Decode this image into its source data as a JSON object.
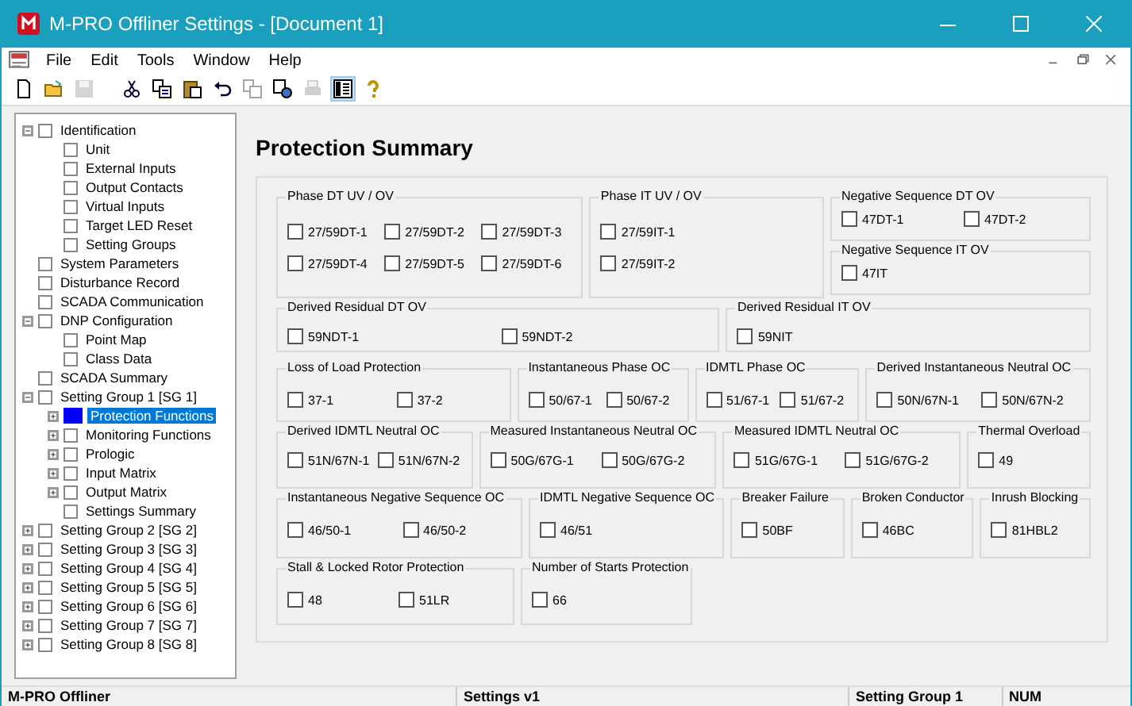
{
  "window": {
    "title": "M-PRO Offliner Settings - [Document 1]"
  },
  "menu": [
    "File",
    "Edit",
    "Tools",
    "Window",
    "Help"
  ],
  "toolbar": [
    {
      "kind": "new",
      "disabled": false,
      "selected": false
    },
    {
      "kind": "open",
      "disabled": false,
      "selected": false
    },
    {
      "kind": "save",
      "disabled": true,
      "selected": false
    },
    {
      "kind": "sep"
    },
    {
      "kind": "cut",
      "disabled": false,
      "selected": false
    },
    {
      "kind": "copy",
      "disabled": false,
      "selected": false
    },
    {
      "kind": "paste",
      "disabled": false,
      "selected": false
    },
    {
      "kind": "undo",
      "disabled": false,
      "selected": false
    },
    {
      "kind": "compare",
      "disabled": true,
      "selected": false
    },
    {
      "kind": "merge",
      "disabled": false,
      "selected": false
    },
    {
      "kind": "print",
      "disabled": true,
      "selected": false
    },
    {
      "kind": "view",
      "disabled": false,
      "selected": true
    },
    {
      "kind": "help",
      "disabled": false,
      "selected": false
    }
  ],
  "tree": [
    {
      "label": "Identification",
      "checked": false,
      "selected": false,
      "expanded": true,
      "children": [
        {
          "label": "Unit",
          "checked": false,
          "selected": false
        },
        {
          "label": "External Inputs",
          "checked": false,
          "selected": false
        },
        {
          "label": "Output Contacts",
          "checked": false,
          "selected": false
        },
        {
          "label": "Virtual Inputs",
          "checked": false,
          "selected": false
        },
        {
          "label": "Target LED Reset",
          "checked": false,
          "selected": false
        },
        {
          "label": "Setting Groups",
          "checked": false,
          "selected": false
        }
      ]
    },
    {
      "label": "System Parameters",
      "checked": false,
      "selected": false
    },
    {
      "label": "Disturbance Record",
      "checked": false,
      "selected": false
    },
    {
      "label": "SCADA Communication",
      "checked": false,
      "selected": false
    },
    {
      "label": "DNP Configuration",
      "checked": false,
      "selected": false,
      "expanded": true,
      "children": [
        {
          "label": "Point Map",
          "checked": false,
          "selected": false
        },
        {
          "label": "Class Data",
          "checked": false,
          "selected": false
        }
      ]
    },
    {
      "label": "SCADA Summary",
      "checked": false,
      "selected": false
    },
    {
      "label": "Setting Group 1 [SG 1]",
      "checked": false,
      "selected": false,
      "expanded": true,
      "children": [
        {
          "label": "Protection Functions",
          "checked": true,
          "selected": true,
          "expanded": false
        },
        {
          "label": "Monitoring Functions",
          "checked": false,
          "selected": false,
          "expanded": false
        },
        {
          "label": "Prologic",
          "checked": false,
          "selected": false,
          "expanded": false
        },
        {
          "label": "Input Matrix",
          "checked": false,
          "selected": false,
          "expanded": false
        },
        {
          "label": "Output Matrix",
          "checked": false,
          "selected": false,
          "expanded": false
        },
        {
          "label": "Settings Summary",
          "checked": false,
          "selected": false
        }
      ]
    },
    {
      "label": "Setting Group 2 [SG 2]",
      "checked": false,
      "selected": false,
      "expanded": false
    },
    {
      "label": "Setting Group 3 [SG 3]",
      "checked": false,
      "selected": false,
      "expanded": false
    },
    {
      "label": "Setting Group 4 [SG 4]",
      "checked": false,
      "selected": false,
      "expanded": false
    },
    {
      "label": "Setting Group 5 [SG 5]",
      "checked": false,
      "selected": false,
      "expanded": false
    },
    {
      "label": "Setting Group 6 [SG 6]",
      "checked": false,
      "selected": false,
      "expanded": false
    },
    {
      "label": "Setting Group 7 [SG 7]",
      "checked": false,
      "selected": false,
      "expanded": false
    },
    {
      "label": "Setting Group 8 [SG 8]",
      "checked": false,
      "selected": false,
      "expanded": false
    }
  ],
  "heading": "Protection Summary",
  "rows": [
    {
      "groups": [
        {
          "kind": "group",
          "title": "Phase DT UV / OV",
          "items": [
            {
              "label": "27/59DT-1",
              "checked": false
            },
            {
              "label": "27/59DT-2",
              "checked": false
            },
            {
              "label": "27/59DT-3",
              "checked": false
            },
            {
              "label": "27/59DT-4",
              "checked": false
            },
            {
              "label": "27/59DT-5",
              "checked": false
            },
            {
              "label": "27/59DT-6",
              "checked": false
            }
          ]
        },
        {
          "kind": "group",
          "title": "Phase IT UV / OV",
          "items": [
            {
              "label": "27/59IT-1",
              "checked": false
            },
            {
              "label": "27/59IT-2",
              "checked": false
            }
          ]
        },
        {
          "kind": "stack",
          "groups": [
            {
              "kind": "group",
              "title": "Negative Sequence DT OV",
              "items": [
                {
                  "label": "47DT-1",
                  "checked": false
                },
                {
                  "label": "47DT-2",
                  "checked": false
                }
              ]
            },
            {
              "kind": "group",
              "title": "Negative Sequence IT OV",
              "items": [
                {
                  "label": "47IT",
                  "checked": false
                }
              ]
            }
          ]
        }
      ]
    },
    {
      "groups": [
        {
          "kind": "group",
          "title": "Derived Residual DT OV",
          "items": [
            {
              "label": "59NDT-1",
              "checked": false
            },
            {
              "label": "59NDT-2",
              "checked": false
            }
          ]
        },
        {
          "kind": "group",
          "title": "Derived Residual IT OV",
          "items": [
            {
              "label": "59NIT",
              "checked": false
            }
          ]
        }
      ]
    },
    {
      "groups": [
        {
          "kind": "group",
          "title": "Loss of Load Protection",
          "items": [
            {
              "label": "37-1",
              "checked": false
            },
            {
              "label": "37-2",
              "checked": false
            }
          ]
        },
        {
          "kind": "group",
          "title": "Instantaneous Phase OC",
          "items": [
            {
              "label": "50/67-1",
              "checked": false
            },
            {
              "label": "50/67-2",
              "checked": false
            }
          ]
        },
        {
          "kind": "group",
          "title": "IDMTL Phase OC",
          "items": [
            {
              "label": "51/67-1",
              "checked": false
            },
            {
              "label": "51/67-2",
              "checked": false
            }
          ]
        },
        {
          "kind": "group",
          "title": "Derived Instantaneous Neutral OC",
          "items": [
            {
              "label": "50N/67N-1",
              "checked": false
            },
            {
              "label": "50N/67N-2",
              "checked": false
            }
          ]
        }
      ]
    },
    {
      "groups": [
        {
          "kind": "group",
          "title": "Derived IDMTL Neutral OC",
          "items": [
            {
              "label": "51N/67N-1",
              "checked": false
            },
            {
              "label": "51N/67N-2",
              "checked": false
            }
          ]
        },
        {
          "kind": "group",
          "title": "Measured Instantaneous Neutral OC",
          "items": [
            {
              "label": "50G/67G-1",
              "checked": false
            },
            {
              "label": "50G/67G-2",
              "checked": false
            }
          ]
        },
        {
          "kind": "group",
          "title": "Measured IDMTL Neutral OC",
          "items": [
            {
              "label": "51G/67G-1",
              "checked": false
            },
            {
              "label": "51G/67G-2",
              "checked": false
            }
          ]
        },
        {
          "kind": "group",
          "title": "Thermal Overload",
          "items": [
            {
              "label": "49",
              "checked": false
            }
          ]
        }
      ]
    },
    {
      "groups": [
        {
          "kind": "group",
          "title": "Instantaneous Negative Sequence OC",
          "items": [
            {
              "label": "46/50-1",
              "checked": false
            },
            {
              "label": "46/50-2",
              "checked": false
            }
          ]
        },
        {
          "kind": "group",
          "title": "IDMTL Negative Sequence OC",
          "items": [
            {
              "label": "46/51",
              "checked": false
            }
          ]
        },
        {
          "kind": "group",
          "title": "Breaker Failure",
          "items": [
            {
              "label": "50BF",
              "checked": false
            }
          ]
        },
        {
          "kind": "group",
          "title": "Broken Conductor",
          "items": [
            {
              "label": "46BC",
              "checked": false
            }
          ]
        },
        {
          "kind": "group",
          "title": "Inrush Blocking",
          "items": [
            {
              "label": "81HBL2",
              "checked": false
            }
          ]
        }
      ]
    },
    {
      "groups": [
        {
          "kind": "group",
          "title": "Stall & Locked Rotor Protection",
          "items": [
            {
              "label": "48",
              "checked": false
            },
            {
              "label": "51LR",
              "checked": false
            }
          ]
        },
        {
          "kind": "group",
          "title": "Number of Starts Protection",
          "items": [
            {
              "label": "66",
              "checked": false
            }
          ]
        }
      ]
    }
  ],
  "status_bar": [
    "M-PRO Offliner",
    "Settings v1",
    "Setting Group 1",
    "NUM"
  ]
}
